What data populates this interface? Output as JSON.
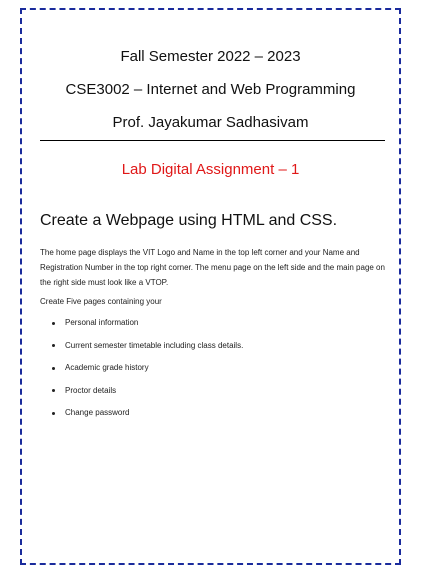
{
  "document": {
    "semester": "Fall Semester 2022 – 2023",
    "course": "CSE3002 – Internet and Web Programming",
    "professor": "Prof. Jayakumar Sadhasivam",
    "assignment_title": "Lab Digital Assignment – 1",
    "task_heading": "Create a Webpage using HTML and CSS.",
    "description": "The home page displays the VIT Logo and Name in the top left corner and your Name and Registration Number in the top right corner. The menu page on the left side and the main page on the right side must look like a VTOP.",
    "pages_intro": "Create Five pages containing your",
    "pages": [
      "Personal information",
      "Current semester timetable including class details.",
      "Academic grade history",
      "Proctor details",
      "Change password"
    ]
  },
  "colors": {
    "border": "#1a2b9c",
    "assignment_title": "#e01818",
    "text": "#111111"
  }
}
